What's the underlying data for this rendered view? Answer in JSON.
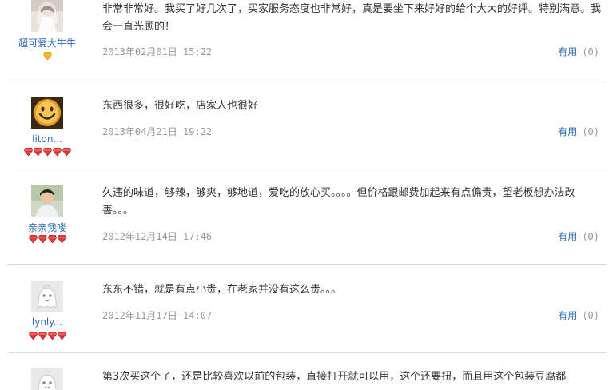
{
  "reviews": [
    {
      "username": "超可爱大牛牛",
      "avatar": "bride-photo-avatar",
      "badge_icon": "gold-diamond-icon",
      "badges": 1,
      "content": "非常非常好。我买了好几次了，买家服务态度也非常好，真是要坐下来好好的给个大大的好评。特别满意。我会一直光顾的！",
      "date": "2013年02月01日 15:22",
      "useful_label": "有用",
      "useful_count": "(0)"
    },
    {
      "username": "liton...",
      "avatar": "smiley-face-avatar",
      "badge_icon": "red-diamond-icon",
      "badges": 5,
      "content": "东西很多，很好吃，店家人也很好",
      "date": "2013年04月21日 19:22",
      "useful_label": "有用",
      "useful_count": "(0)"
    },
    {
      "username": "亲亲我喽",
      "avatar": "man-photo-avatar",
      "badge_icon": "red-diamond-icon",
      "badges": 4,
      "content": "久违的味道，够辣，够爽，够地道，爱吃的放心买。。。。但价格跟邮费加起来有点偏贵，望老板想办法改善。。。",
      "date": "2012年12月14日 17:46",
      "useful_label": "有用",
      "useful_count": "(0)"
    },
    {
      "username": "lynly...",
      "avatar": "default-ghost-avatar",
      "badge_icon": "red-diamond-icon",
      "badges": 4,
      "content": "东东不错，就是有点小贵，在老家并没有这么贵。。。",
      "date": "2012年11月17日 14:07",
      "useful_label": "有用",
      "useful_count": "(0)"
    },
    {
      "username": "",
      "avatar": "default-ghost-avatar",
      "badge_icon": "",
      "badges": 0,
      "content": "第3次买这个了，还是比较喜欢以前的包装，直接打开就可以用，这个还要扭，而且用这个包装豆腐都",
      "date": "",
      "useful_label": "",
      "useful_count": ""
    }
  ],
  "colors": {
    "link": "#2a6bb5",
    "muted": "#999999",
    "divider": "#d9d9d9",
    "badge_red": "#e03a3a",
    "badge_gold": "#f2b515"
  }
}
